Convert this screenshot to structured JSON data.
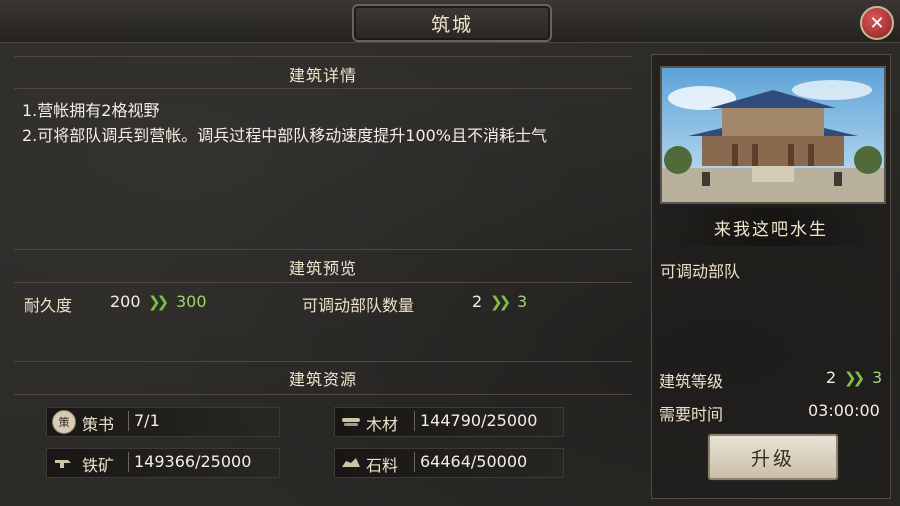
{
  "title": "筑城",
  "close_icon": "close-icon",
  "details": {
    "header": "建筑详情",
    "lines": [
      "1.营帐拥有2格视野",
      "2.可将部队调兵到营帐。调兵过程中部队移动速度提升100%且不消耗士气"
    ]
  },
  "preview": {
    "header": "建筑预览",
    "durability": {
      "label": "耐久度",
      "from": "200",
      "to": "300"
    },
    "troops": {
      "label": "可调动部队数量",
      "from": "2",
      "to": "3"
    }
  },
  "resources": {
    "header": "建筑资源",
    "items": [
      {
        "icon": "book-icon",
        "badge": "策",
        "label": "策书",
        "value": "7/1"
      },
      {
        "icon": "wood-icon",
        "label": "木材",
        "value": "144790/25000"
      },
      {
        "icon": "iron-icon",
        "label": "铁矿",
        "value": "149366/25000"
      },
      {
        "icon": "stone-icon",
        "label": "石料",
        "value": "64464/50000"
      }
    ]
  },
  "side": {
    "name": "来我这吧水生",
    "desc": "可调动部队",
    "level": {
      "label": "建筑等级",
      "from": "2",
      "to": "3"
    },
    "time": {
      "label": "需要时间",
      "value": "03:00:00"
    },
    "upgrade_label": "升级"
  },
  "colors": {
    "accent_green": "#9ed46c",
    "arrow_green": "#7ec047",
    "close_red": "#8e1e22"
  }
}
